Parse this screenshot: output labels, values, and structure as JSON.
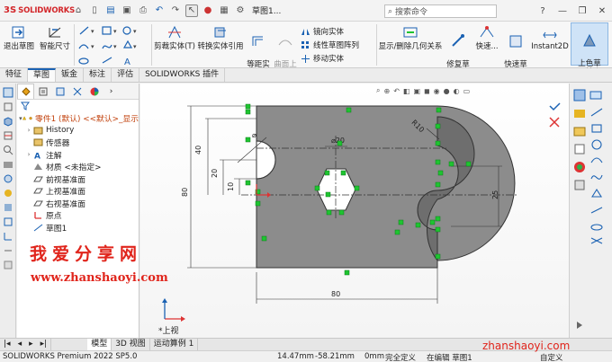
{
  "titlebar": {
    "brand_ds": "3S",
    "brand_name": "SOLIDWORKS",
    "doc_title": "草图1...",
    "search_placeholder": "搜索命令",
    "help": "?",
    "minimize": "—",
    "restore": "❐",
    "close": "✕"
  },
  "ribbon": {
    "exit_sketch": "退出草图",
    "smart_dim": "智能尺寸",
    "trim": "剪裁实体(T)",
    "convert": "转换实体引用",
    "offset": "等距实\n体",
    "surface_offset": "曲面上\n偏移",
    "mirror": "镜向实体",
    "linear_pattern": "线性草图阵列",
    "move": "移动实体",
    "show_hide": "显示/删除几何关系",
    "repair": "修复草\n图",
    "quick1": "快速...",
    "quick2": "快速草\n图",
    "instant2d": "Instant2D",
    "shaded": "上色草\n图轮廓"
  },
  "tabs": [
    "特征",
    "草图",
    "钣金",
    "标注",
    "评估",
    "SOLIDWORKS 插件"
  ],
  "active_tab": 1,
  "tree": {
    "root": "零件1 (默认) <<默认>_显示",
    "items": [
      "History",
      "传感器",
      "注解",
      "材质 <未指定>",
      "前视基准面",
      "上视基准面",
      "右视基准面",
      "原点",
      "草图1"
    ]
  },
  "watermark": {
    "cn": "我爱分享网",
    "url": "www.zhanshaoyi.com",
    "corner": "zhanshaoyi.com"
  },
  "drawing": {
    "dim_40": "40",
    "dim_80_left": "80",
    "dim_20": "20",
    "dim_10": "10",
    "dim_80_bottom": "80",
    "dim_25": "25",
    "dim_phi20_hole": "⌀20",
    "dim_phi20_left": "⌀",
    "dim_r10": "R10",
    "view_label": "*上视"
  },
  "bottom_tabs": [
    "模型",
    "3D 视图",
    "运动算例 1"
  ],
  "status": {
    "app": "SOLIDWORKS Premium 2022 SP5.0",
    "x": "14.47mm",
    "y": "-58.21mm",
    "z": "0mm",
    "state": "完全定义",
    "editing": "在编辑 草图1",
    "custom": "自定义"
  },
  "colors": {
    "accent": "#1b62b3",
    "part_fill": "#8c8c8c",
    "slot_fill": "#6e6e6e",
    "constraint": "#1fc431",
    "watermark": "#e0241b"
  }
}
